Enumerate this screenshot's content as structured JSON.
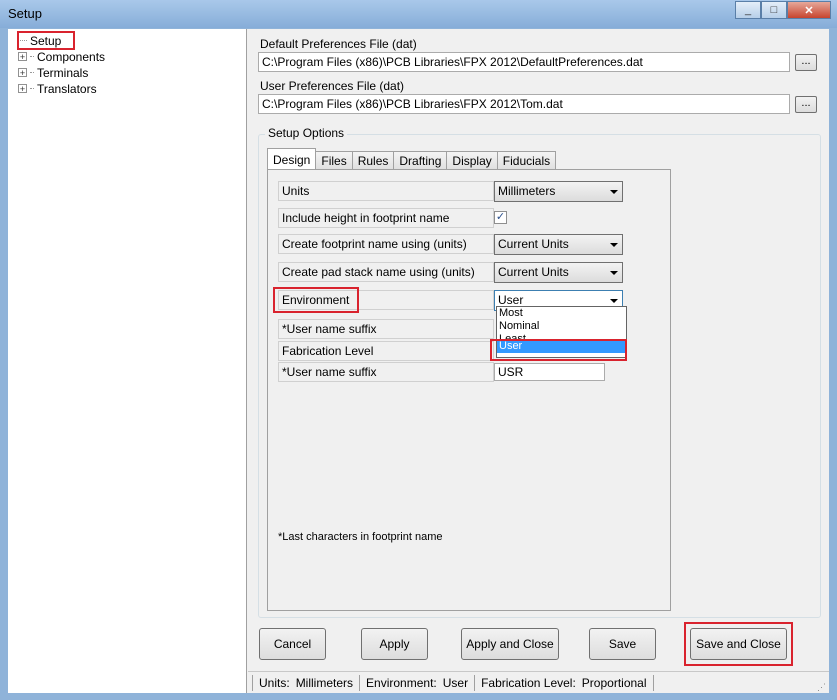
{
  "window": {
    "title": "Setup"
  },
  "tree": [
    {
      "label": "Setup",
      "expandable": false
    },
    {
      "label": "Components",
      "expandable": true
    },
    {
      "label": "Terminals",
      "expandable": true
    },
    {
      "label": "Translators",
      "expandable": true
    }
  ],
  "prefs": {
    "default_label": "Default Preferences File  (dat)",
    "default_path": "C:\\Program Files (x86)\\PCB Libraries\\FPX 2012\\DefaultPreferences.dat",
    "user_label": "User Preferences File  (dat)",
    "user_path": "C:\\Program Files (x86)\\PCB Libraries\\FPX 2012\\Tom.dat",
    "browse": "..."
  },
  "setup_options": {
    "label": "Setup Options",
    "tabs": [
      "Design",
      "Files",
      "Rules",
      "Drafting",
      "Display",
      "Fiducials"
    ],
    "rows": {
      "units": {
        "label": "Units",
        "value": "Millimeters"
      },
      "height": {
        "label": "Include height in footprint name",
        "checked": "✓"
      },
      "fp_name": {
        "label": "Create footprint name using (units)",
        "value": "Current Units"
      },
      "pad_name": {
        "label": "Create pad stack name using (units)",
        "value": "Current Units"
      },
      "environment": {
        "label": "Environment",
        "value": "User"
      },
      "suffix1": {
        "label": "*User name suffix"
      },
      "fab": {
        "label": "Fabrication Level"
      },
      "suffix2": {
        "label": "*User name suffix",
        "value": "USR"
      }
    },
    "env_options": [
      "Most",
      "Nominal",
      "Least",
      "User"
    ],
    "note": "*Last characters in footprint name"
  },
  "buttons": {
    "cancel": "Cancel",
    "apply": "Apply",
    "apply_close": "Apply and Close",
    "save": "Save",
    "save_close": "Save and Close"
  },
  "status": {
    "units_label": "Units:",
    "units_value": "Millimeters",
    "env_label": "Environment:",
    "env_value": "User",
    "fab_label": "Fabrication Level:",
    "fab_value": "Proportional"
  },
  "colors": {
    "highlight": "#d9232e",
    "selection": "#3399ff"
  }
}
